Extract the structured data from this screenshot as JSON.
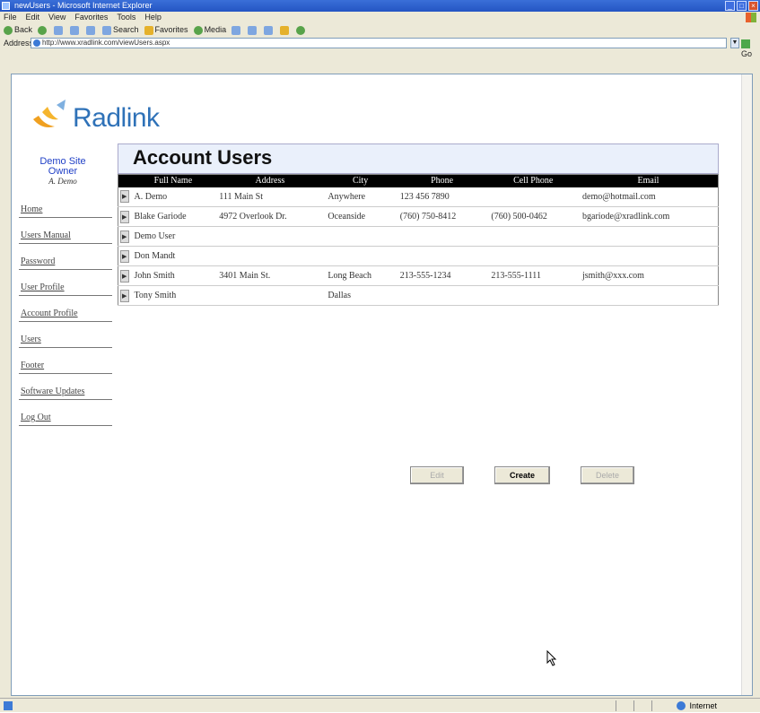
{
  "browser": {
    "title": "newUsers - Microsoft Internet Explorer",
    "menu": [
      "File",
      "Edit",
      "View",
      "Favorites",
      "Tools",
      "Help"
    ],
    "toolbar": {
      "back": "Back",
      "search": "Search",
      "favorites": "Favorites",
      "media": "Media"
    },
    "address_label": "Address",
    "address_value": "http://www.xradlink.com/viewUsers.aspx",
    "go_label": "Go",
    "status_zone": "Internet"
  },
  "logo": {
    "text": "Radlink"
  },
  "owner": {
    "site": "Demo Site",
    "role": "Owner",
    "name": "A. Demo"
  },
  "nav": [
    "Home",
    "Users Manual",
    "Password",
    "User Profile",
    "Account Profile",
    "Users",
    "Footer",
    "Software Updates",
    "Log Out"
  ],
  "page": {
    "title": "Account Users"
  },
  "table": {
    "headers": [
      "Full Name",
      "Address",
      "City",
      "Phone",
      "Cell Phone",
      "Email"
    ],
    "rows": [
      [
        "A. Demo",
        "111 Main St",
        "Anywhere",
        "123 456 7890",
        "",
        "demo@hotmail.com"
      ],
      [
        "Blake Gariode",
        "4972 Overlook Dr.",
        "Oceanside",
        "(760) 750-8412",
        "(760) 500-0462",
        "bgariode@xradlink.com"
      ],
      [
        "Demo User",
        "",
        "",
        "",
        "",
        ""
      ],
      [
        "Don Mandt",
        "",
        "",
        "",
        "",
        ""
      ],
      [
        "John Smith",
        "3401 Main St.",
        "Long Beach",
        "213-555-1234",
        "213-555-1111",
        "jsmith@xxx.com"
      ],
      [
        "Tony Smith",
        "",
        "Dallas",
        "",
        "",
        ""
      ]
    ]
  },
  "buttons": {
    "edit": "Edit",
    "create": "Create",
    "delete": "Delete"
  },
  "colors": {
    "accent": "#1f3fc6",
    "header_bg": "#eaf0fb",
    "table_header": "#000000"
  }
}
